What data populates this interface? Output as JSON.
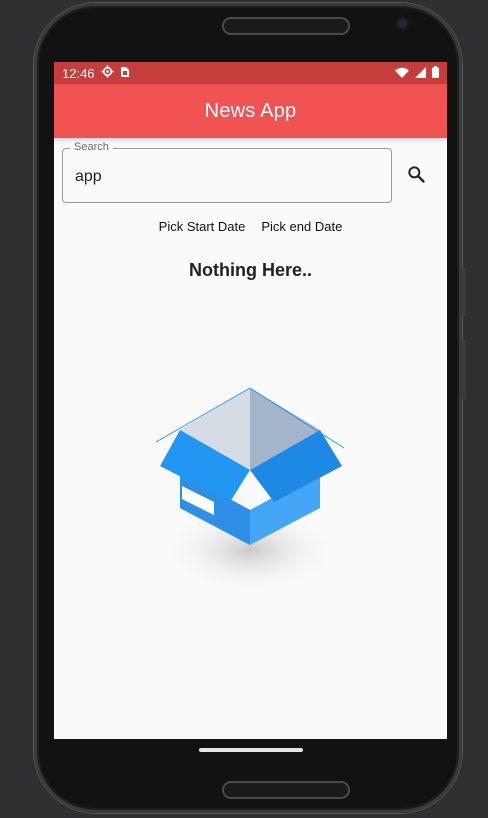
{
  "status_bar": {
    "time": "12:46"
  },
  "app_bar": {
    "title": "News App"
  },
  "search": {
    "label": "Search",
    "value": "app"
  },
  "date_buttons": {
    "start_label": "Pick Start Date",
    "end_label": "Pick end Date"
  },
  "empty_state": {
    "title": "Nothing Here.."
  },
  "colors": {
    "status_bar": "#c53d3d",
    "app_bar": "#f15252",
    "box_blue": "#2196f3",
    "box_light_blue": "#42a5f5",
    "box_top_gray": "#d5dce4",
    "box_top_dark": "#a3b5c8"
  },
  "icons": {
    "status": [
      "settings-icon",
      "sim-card-icon",
      "wifi-icon",
      "signal-icon",
      "battery-icon"
    ],
    "search": "search-icon",
    "illustration": "empty-box-icon"
  }
}
